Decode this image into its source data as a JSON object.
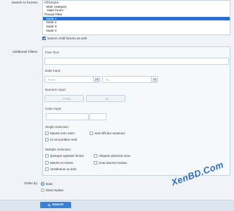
{
  "search_in_forums": {
    "label": "Search in forums:",
    "options": [
      {
        "text": "All forums",
        "indent": 0,
        "selected": false
      },
      {
        "text": "Main category",
        "indent": 1,
        "selected": false
      },
      {
        "text": "Main forum",
        "indent": 2,
        "selected": false
      },
      {
        "text": "Thread Filter",
        "indent": 0,
        "selected": false
      },
      {
        "text": "Node 1",
        "indent": 1,
        "selected": true
      },
      {
        "text": "Node 2",
        "indent": 1,
        "selected": false
      },
      {
        "text": "Node 3",
        "indent": 1,
        "selected": false
      },
      {
        "text": "Node 4",
        "indent": 1,
        "selected": false
      }
    ],
    "child_checkbox_label": "Search child forums as well",
    "child_checked": true
  },
  "additional_filters": {
    "label": "Additional Filters:",
    "free_text_label": "Free Text:",
    "date_input_label": "Date Input:",
    "date_from_placeholder": "From...",
    "date_to_placeholder": "To...",
    "numeric_input_label": "Numeric Input:",
    "numeric_from_placeholder": "From...",
    "numeric_to_placeholder": "To...",
    "color_input_label": "Color Input:",
    "single_selection_label": "Single Selection:",
    "single_options": [
      "Mauris sem enim",
      "Sed efficitur euismod",
      "Ut vel porttitor velit"
    ],
    "multiple_selection_label": "Multiple Selection:",
    "multiple_options": [
      "Quisque egestas lectus",
      "Aliquam placerat urna",
      "Mauris et metus",
      "Cras laoreet massa",
      "Vestibulum ut dolo"
    ]
  },
  "order_by": {
    "label": "Order by:",
    "options": [
      {
        "text": "Date",
        "checked": true
      },
      {
        "text": "Most replies",
        "checked": false
      }
    ]
  },
  "search_button": {
    "label": "Search",
    "icon": "search-icon"
  },
  "watermark": "XenBD.Com",
  "colors": {
    "accent": "#2f6fc7",
    "button": "#3b82d4",
    "background": "#f0f4f8"
  }
}
